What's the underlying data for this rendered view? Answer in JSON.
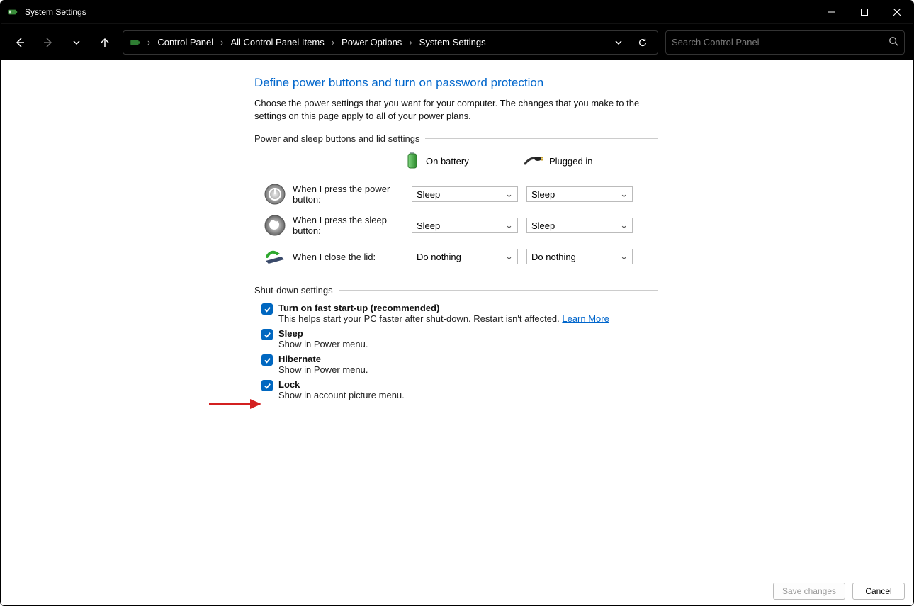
{
  "window": {
    "title": "System Settings"
  },
  "breadcrumbs": {
    "item0": "Control Panel",
    "item1": "All Control Panel Items",
    "item2": "Power Options",
    "item3": "System Settings"
  },
  "search": {
    "placeholder": "Search Control Panel"
  },
  "page": {
    "heading": "Define power buttons and turn on password protection",
    "description": "Choose the power settings that you want for your computer. The changes that you make to the settings on this page apply to all of your power plans.",
    "section1_label": "Power and sleep buttons and lid settings",
    "col_battery": "On battery",
    "col_plugged": "Plugged in",
    "rows": [
      {
        "label": "When I press the power button:",
        "battery": "Sleep",
        "plugged": "Sleep"
      },
      {
        "label": "When I press the sleep button:",
        "battery": "Sleep",
        "plugged": "Sleep"
      },
      {
        "label": "When I close the lid:",
        "battery": "Do nothing",
        "plugged": "Do nothing"
      }
    ],
    "section2_label": "Shut-down settings",
    "shutdown": [
      {
        "title": "Turn on fast start-up (recommended)",
        "desc": "This helps start your PC faster after shut-down. Restart isn't affected. ",
        "link": "Learn More"
      },
      {
        "title": "Sleep",
        "desc": "Show in Power menu."
      },
      {
        "title": "Hibernate",
        "desc": "Show in Power menu."
      },
      {
        "title": "Lock",
        "desc": "Show in account picture menu."
      }
    ]
  },
  "footer": {
    "save": "Save changes",
    "cancel": "Cancel"
  }
}
